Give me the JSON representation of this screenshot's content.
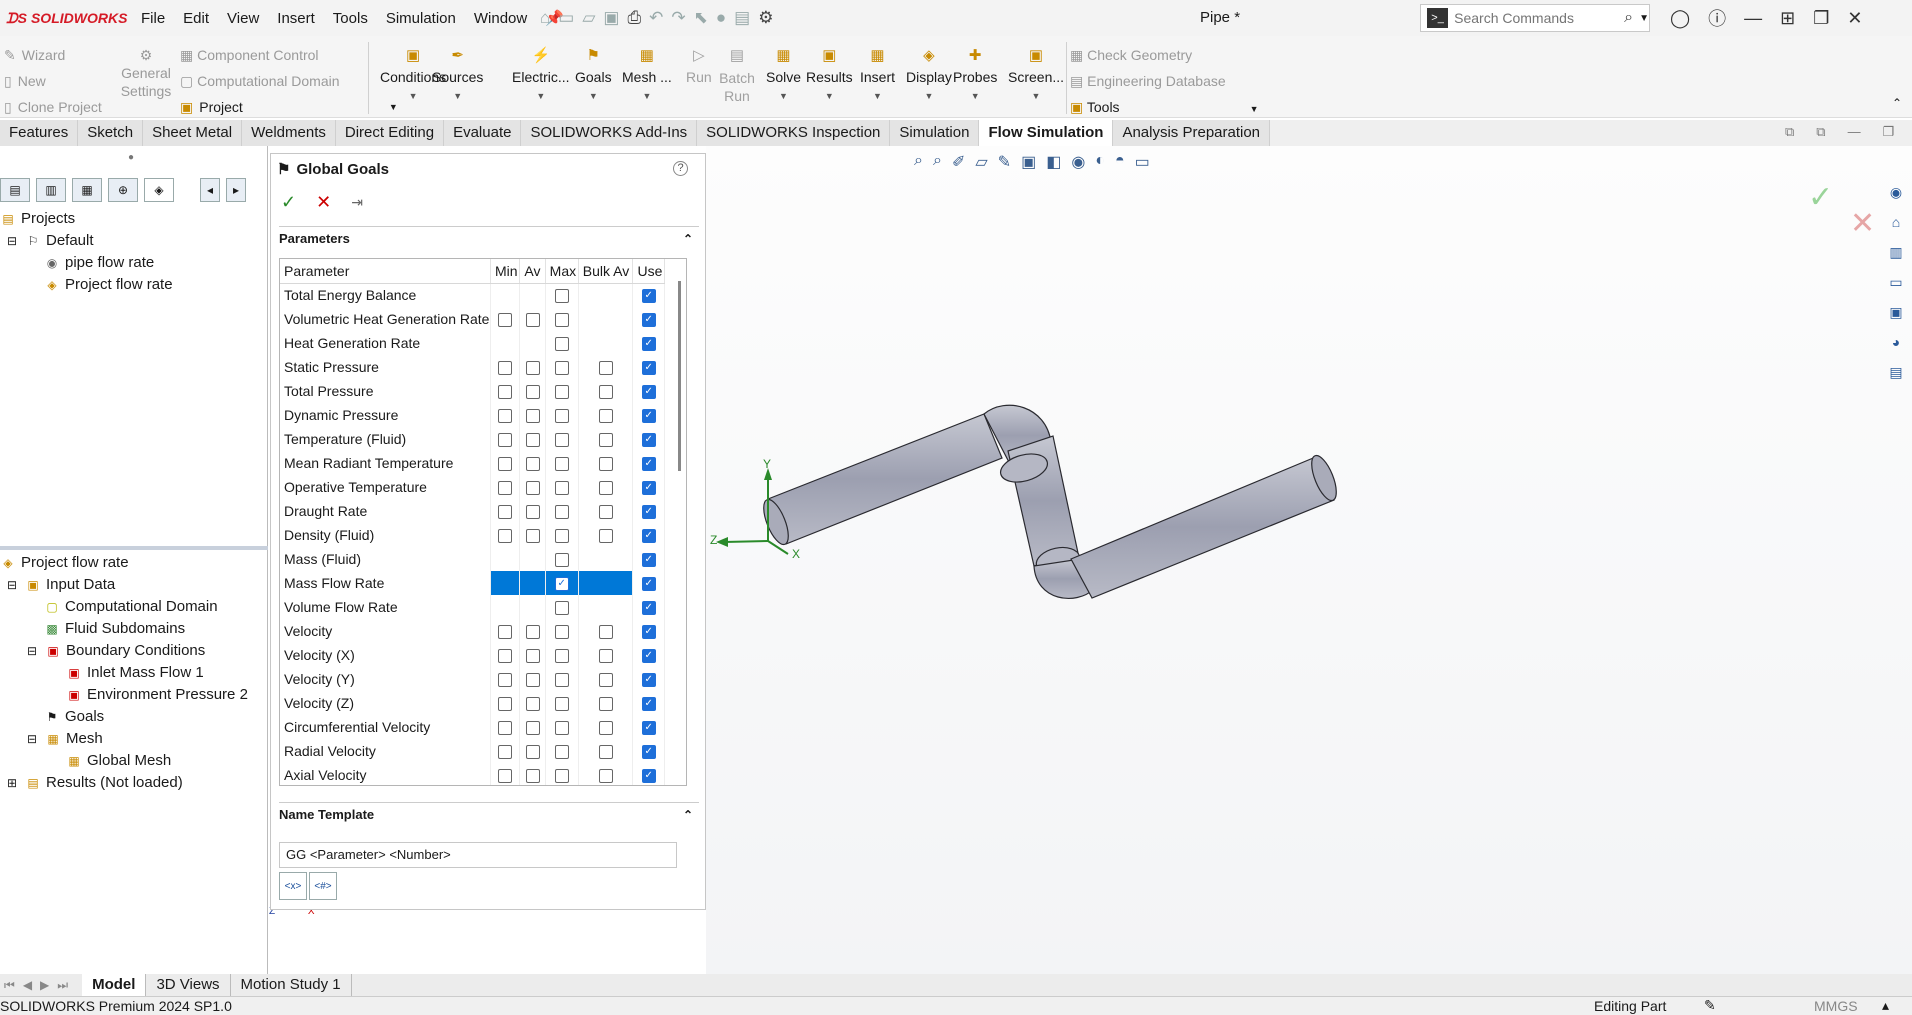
{
  "app": {
    "logo_text": "SOLIDWORKS",
    "doc_title": "Pipe *"
  },
  "menu": [
    "File",
    "Edit",
    "View",
    "Insert",
    "Tools",
    "Simulation",
    "Window"
  ],
  "search": {
    "placeholder": "Search Commands"
  },
  "ribbon": {
    "left_items": [
      "Wizard",
      "New",
      "Clone Project"
    ],
    "general_settings": "General Settings",
    "comp_items": [
      "Component Control",
      "Computational Domain"
    ],
    "project_label": "Project",
    "buttons": [
      {
        "label": "Conditions",
        "enabled": true
      },
      {
        "label": "Sources",
        "enabled": true
      },
      {
        "label": "Electric...",
        "enabled": true
      },
      {
        "label": "Goals",
        "enabled": true
      },
      {
        "label": "Mesh ...",
        "enabled": true
      },
      {
        "label": "Run",
        "enabled": false
      },
      {
        "label": "Batch Run",
        "enabled": false
      },
      {
        "label": "Solve",
        "enabled": true
      },
      {
        "label": "Results",
        "enabled": true
      },
      {
        "label": "Insert",
        "enabled": true
      },
      {
        "label": "Display",
        "enabled": true
      },
      {
        "label": "Probes",
        "enabled": true
      },
      {
        "label": "Screen...",
        "enabled": true
      }
    ],
    "right_items": [
      "Check Geometry",
      "Engineering Database"
    ],
    "tools_label": "Tools"
  },
  "tabs": [
    "Features",
    "Sketch",
    "Sheet Metal",
    "Weldments",
    "Direct Editing",
    "Evaluate",
    "SOLIDWORKS Add-Ins",
    "SOLIDWORKS Inspection",
    "Simulation",
    "Flow Simulation",
    "Analysis Preparation"
  ],
  "active_tab": "Flow Simulation",
  "tree_top": {
    "root": "Projects",
    "default": "Default",
    "items": [
      "pipe flow rate",
      "Project flow rate"
    ]
  },
  "tree_bottom": {
    "root": "Project flow rate",
    "input_data": "Input Data",
    "computational_domain": "Computational Domain",
    "fluid_subdomains": "Fluid Subdomains",
    "boundary_conditions": "Boundary Conditions",
    "inlet": "Inlet Mass Flow 1",
    "env": "Environment Pressure 2",
    "goals": "Goals",
    "mesh": "Mesh",
    "global_mesh": "Global Mesh",
    "results": "Results (Not loaded)"
  },
  "panel": {
    "title": "Global Goals",
    "section_parameters": "Parameters",
    "section_name_template": "Name Template",
    "name_template_value": "GG <Parameter> <Number>",
    "tpl_btn1": "<x>",
    "tpl_btn2": "<#>",
    "columns": [
      "Parameter",
      "Min",
      "Av",
      "Max",
      "Bulk Av",
      "Use"
    ],
    "rows": [
      {
        "name": "Total Energy Balance",
        "min": null,
        "av": null,
        "max": false,
        "bulk": null,
        "use": true
      },
      {
        "name": "Volumetric Heat Generation Rate",
        "min": false,
        "av": false,
        "max": false,
        "bulk": null,
        "use": true
      },
      {
        "name": "Heat Generation Rate",
        "min": null,
        "av": null,
        "max": false,
        "bulk": null,
        "use": true
      },
      {
        "name": "Static Pressure",
        "min": false,
        "av": false,
        "max": false,
        "bulk": false,
        "use": true
      },
      {
        "name": "Total Pressure",
        "min": false,
        "av": false,
        "max": false,
        "bulk": false,
        "use": true
      },
      {
        "name": "Dynamic Pressure",
        "min": false,
        "av": false,
        "max": false,
        "bulk": false,
        "use": true
      },
      {
        "name": "Temperature (Fluid)",
        "min": false,
        "av": false,
        "max": false,
        "bulk": false,
        "use": true
      },
      {
        "name": "Mean Radiant Temperature",
        "min": false,
        "av": false,
        "max": false,
        "bulk": false,
        "use": true
      },
      {
        "name": "Operative Temperature",
        "min": false,
        "av": false,
        "max": false,
        "bulk": false,
        "use": true
      },
      {
        "name": "Draught Rate",
        "min": false,
        "av": false,
        "max": false,
        "bulk": false,
        "use": true
      },
      {
        "name": "Density (Fluid)",
        "min": false,
        "av": false,
        "max": false,
        "bulk": false,
        "use": true
      },
      {
        "name": "Mass (Fluid)",
        "min": null,
        "av": null,
        "max": false,
        "bulk": null,
        "use": true
      },
      {
        "name": "Mass Flow Rate",
        "min": null,
        "av": null,
        "max": true,
        "bulk": null,
        "use": true,
        "selected": true
      },
      {
        "name": "Volume Flow Rate",
        "min": null,
        "av": null,
        "max": false,
        "bulk": null,
        "use": true
      },
      {
        "name": "Velocity",
        "min": false,
        "av": false,
        "max": false,
        "bulk": false,
        "use": true
      },
      {
        "name": "Velocity (X)",
        "min": false,
        "av": false,
        "max": false,
        "bulk": false,
        "use": true
      },
      {
        "name": "Velocity (Y)",
        "min": false,
        "av": false,
        "max": false,
        "bulk": false,
        "use": true
      },
      {
        "name": "Velocity (Z)",
        "min": false,
        "av": false,
        "max": false,
        "bulk": false,
        "use": true
      },
      {
        "name": "Circumferential Velocity",
        "min": false,
        "av": false,
        "max": false,
        "bulk": false,
        "use": true
      },
      {
        "name": "Radial Velocity",
        "min": false,
        "av": false,
        "max": false,
        "bulk": false,
        "use": true
      },
      {
        "name": "Axial Velocity",
        "min": false,
        "av": false,
        "max": false,
        "bulk": false,
        "use": true
      }
    ]
  },
  "bottom_tabs": [
    "Model",
    "3D Views",
    "Motion Study 1"
  ],
  "status": {
    "left": "SOLIDWORKS Premium 2024 SP1.0",
    "mode": "Editing Part",
    "units": "MMGS"
  },
  "triad": {
    "x": "X",
    "y": "Y",
    "z": "Z"
  }
}
